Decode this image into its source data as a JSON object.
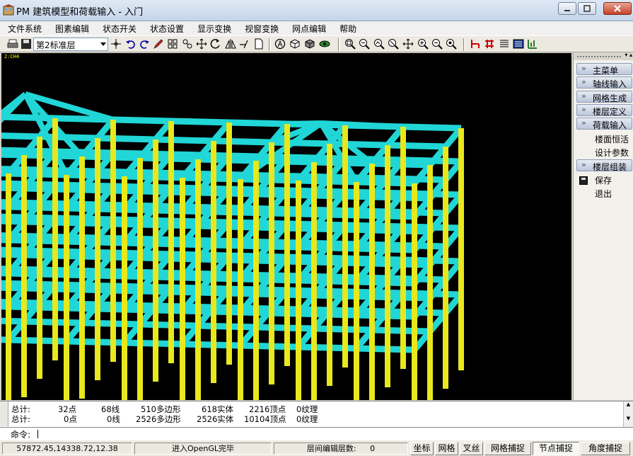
{
  "window": {
    "title": "PM 建筑模型和荷载输入 - 入门"
  },
  "menu": [
    "文件系统",
    "图素编辑",
    "状态开关",
    "状态设置",
    "显示变换",
    "视窗变换",
    "网点编辑",
    "帮助"
  ],
  "toolbar": {
    "floor_value": "第2标准层",
    "icons": [
      "print-icon",
      "save-icon",
      "crosshair-icon",
      "undo-icon",
      "redo-icon",
      "pencil-icon",
      "grid-icon",
      "link-icon",
      "move-icon",
      "rotate-icon",
      "mirror-icon",
      "offset-icon",
      "page-icon",
      "circle-a-icon",
      "cube-icon",
      "cube-shade-icon",
      "eye-icon",
      "zoom-window-icon",
      "zoom-all-icon",
      "zoom-prev-icon",
      "zoom-real-icon",
      "pan-icon",
      "zoom-in-icon",
      "zoom-out-icon",
      "zoom-extent-icon",
      "beam-red-icon",
      "column-red-icon",
      "layers-icon",
      "table-icon",
      "chart-icon"
    ]
  },
  "viewport": {
    "tag": "2:CH4",
    "bg_color": "#000000",
    "beam_color": "#21d6d6",
    "column_color": "#e8e81c"
  },
  "right_panel": {
    "buttons": [
      "主菜单",
      "轴线输入",
      "网格生成",
      "楼层定义",
      "荷载输入"
    ],
    "load_items": [
      "楼面恒活",
      "设计参数"
    ],
    "assembly_button": "楼层组装",
    "assembly_items": [
      "保存",
      "退出"
    ]
  },
  "command": {
    "lines": [
      [
        "总计:",
        "32点",
        "68线",
        "510多边形",
        "618实体",
        "2216顶点",
        "0纹理"
      ],
      [
        "总计:",
        "0点",
        "0线",
        "2526多边形",
        "2526实体",
        "10104顶点",
        "0纹理"
      ]
    ],
    "prompt_label": "命令:"
  },
  "status": {
    "coords": "57872.45,14338.72,12.38",
    "message": "进入OpenGL完毕",
    "floors_label": "层间编辑层数:",
    "floors_value": "0",
    "buttons": [
      "坐标",
      "网格",
      "叉丝",
      "网格捕捉",
      "节点捕捉",
      "角度捕捉"
    ],
    "pressed": "节点捕捉"
  }
}
